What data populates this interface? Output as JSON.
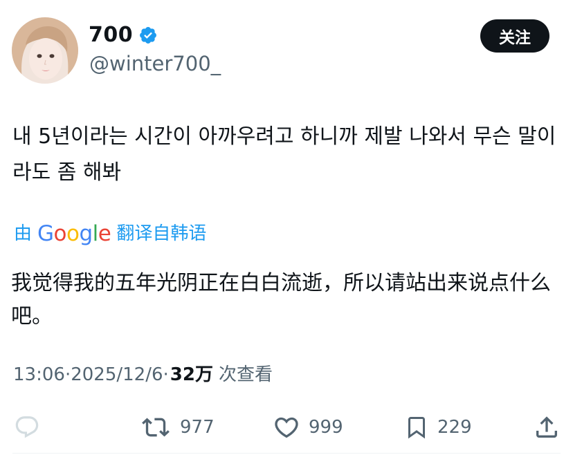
{
  "user": {
    "display_name": "700",
    "handle": "@winter700_",
    "verified_icon": "verified-badge-icon",
    "avatar": "profile-photo"
  },
  "follow_label": "关注",
  "tweet": {
    "text": "내 5년이라는 시간이 아까우려고 하니까 제발 나와서 무슨 말이라도 좀 해봐"
  },
  "translation": {
    "prefix": "由",
    "brand": "Google",
    "suffix": "翻译自韩语",
    "text": "我觉得我的五年光阴正在白白流逝，所以请站出来说点什么吧。"
  },
  "meta": {
    "time": "13:06",
    "sep1": " · ",
    "date": "2025/12/6",
    "sep2": " · ",
    "views_count": "32万",
    "views_label": "次查看"
  },
  "actions": {
    "reply_icon": "reply-icon",
    "retweet_count": "977",
    "like_count": "999",
    "bookmark_count": "229",
    "share_icon": "share-icon"
  },
  "colors": {
    "text": "#0f1419",
    "secondary": "#536471",
    "link": "#1d9bf0",
    "verified": "#1d9bf0",
    "button_bg": "#0f1419",
    "google_blue": "#4285f4",
    "google_red": "#ea4335",
    "google_yellow": "#fbbc05",
    "google_green": "#34a853"
  }
}
